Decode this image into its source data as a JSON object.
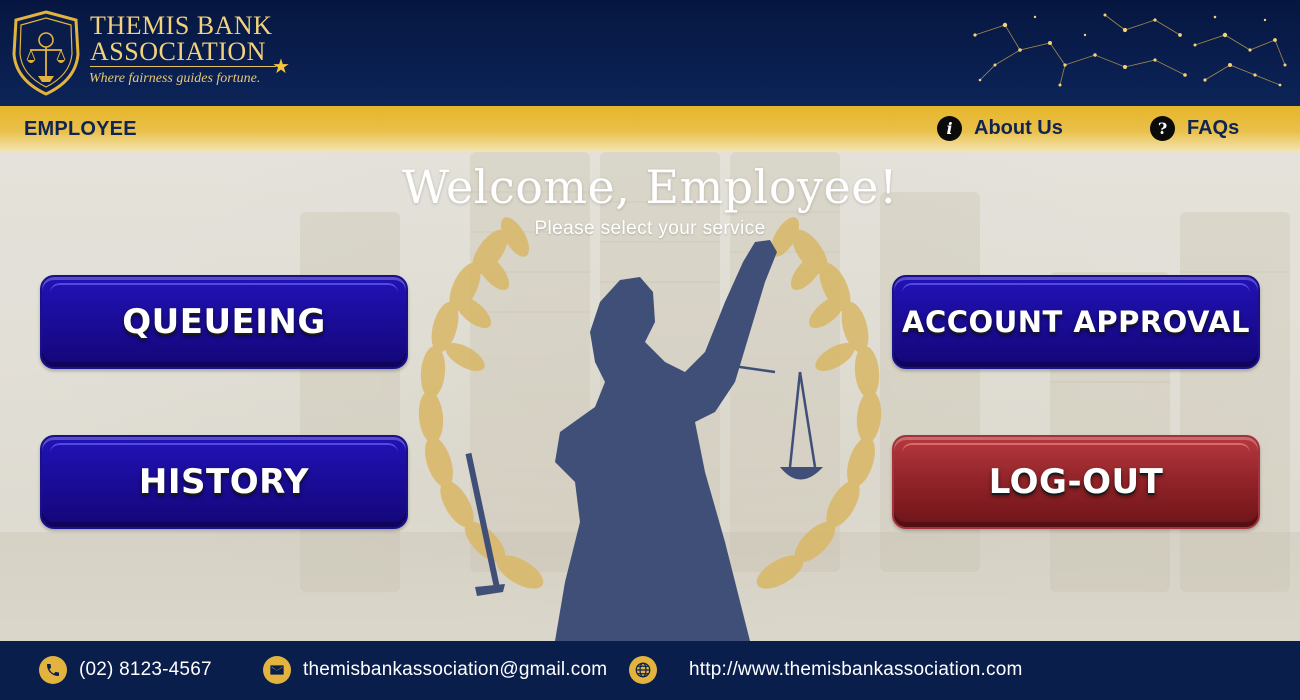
{
  "brand": {
    "line1": "THEMIS BANK",
    "line2": "ASSOCIATION",
    "tagline": "Where fairness guides fortune.",
    "logo_icon": "scales-of-justice-badge-icon",
    "decoration_icon": "constellation-icon",
    "colors": {
      "navy": "#0c2458",
      "gold": "#e6b52a",
      "button_blue": "#1b0d9a",
      "button_red": "#902328"
    }
  },
  "navbar": {
    "role": "EMPLOYEE",
    "about_label": "About Us",
    "about_icon": "info-icon",
    "faqs_label": "FAQs",
    "faqs_icon": "question-icon"
  },
  "main": {
    "title": "Welcome, Employee!",
    "subtitle": "Please select your service",
    "emblem_icon": "lady-justice-laurel-icon",
    "buttons": {
      "queueing": "QUEUEING",
      "history": "HISTORY",
      "account_approval": "ACCOUNT APPROVAL",
      "logout": "LOG-OUT"
    }
  },
  "footer": {
    "phone": "(02) 8123-4567",
    "phone_icon": "phone-icon",
    "email": "themisbankassociation@gmail.com",
    "email_icon": "envelope-icon",
    "website": "http://www.themisbankassociation.com",
    "website_icon": "globe-icon"
  }
}
